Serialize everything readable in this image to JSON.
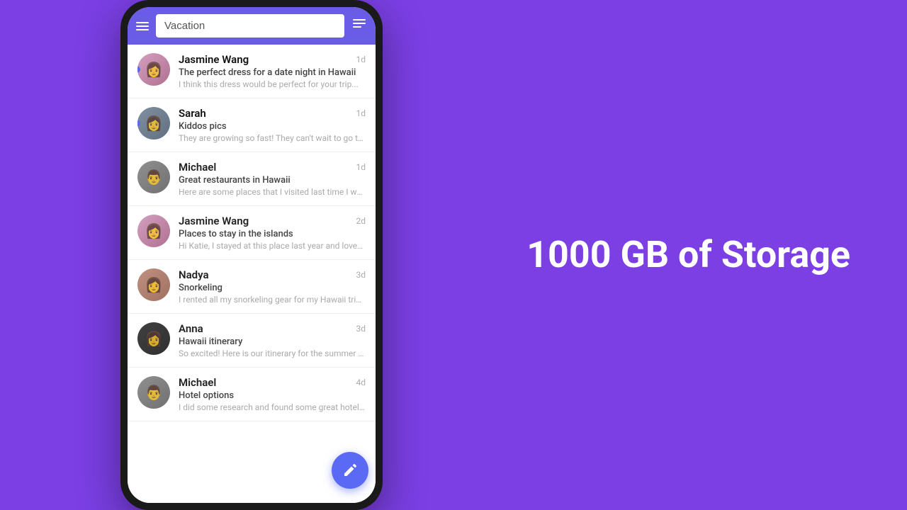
{
  "search": {
    "placeholder": "Vacation",
    "value": "Vacation"
  },
  "messages": [
    {
      "id": 1,
      "sender": "Jasmine Wang",
      "subject": "The perfect dress for a date night in Hawaii",
      "preview": "I think this dress would be perfect for your trip...",
      "timestamp": "1d",
      "unread": true,
      "avatar_style": "avatar-jasmine1",
      "avatar_icon": "👩"
    },
    {
      "id": 2,
      "sender": "Sarah",
      "subject": "Kiddos pics",
      "preview": "They are growing so fast! They can't wait to go to...",
      "timestamp": "1d",
      "unread": true,
      "avatar_style": "avatar-sarah",
      "avatar_icon": "👩"
    },
    {
      "id": 3,
      "sender": "Michael",
      "subject": "Great restaurants in Hawaii",
      "preview": "Here are some places that I visited last time I was t...",
      "timestamp": "1d",
      "unread": false,
      "avatar_style": "avatar-michael1",
      "avatar_icon": "👨"
    },
    {
      "id": 4,
      "sender": "Jasmine Wang",
      "subject": "Places to stay in the islands",
      "preview": "Hi Katie, I stayed at this place last year and loved it...",
      "timestamp": "2d",
      "unread": false,
      "avatar_style": "avatar-jasmine2",
      "avatar_icon": "👩"
    },
    {
      "id": 5,
      "sender": "Nadya",
      "subject": "Snorkeling",
      "preview": "I rented all my snorkeling gear for my Hawaii trip la...",
      "timestamp": "3d",
      "unread": false,
      "avatar_style": "avatar-nadya",
      "avatar_icon": "👩"
    },
    {
      "id": 6,
      "sender": "Anna",
      "subject": "Hawaii itinerary",
      "preview": "So excited! Here is our itinerary for the summer trip",
      "timestamp": "3d",
      "unread": false,
      "avatar_style": "avatar-anna",
      "avatar_icon": "👩"
    },
    {
      "id": 7,
      "sender": "Michael",
      "subject": "Hotel options",
      "preview": "I did some research and found some great hotels o...",
      "timestamp": "4d",
      "unread": false,
      "avatar_style": "avatar-michael2",
      "avatar_icon": "👨"
    }
  ],
  "promo": {
    "line1": "1000 GB of Storage"
  },
  "fab": {
    "icon": "✏️",
    "label": "compose"
  }
}
